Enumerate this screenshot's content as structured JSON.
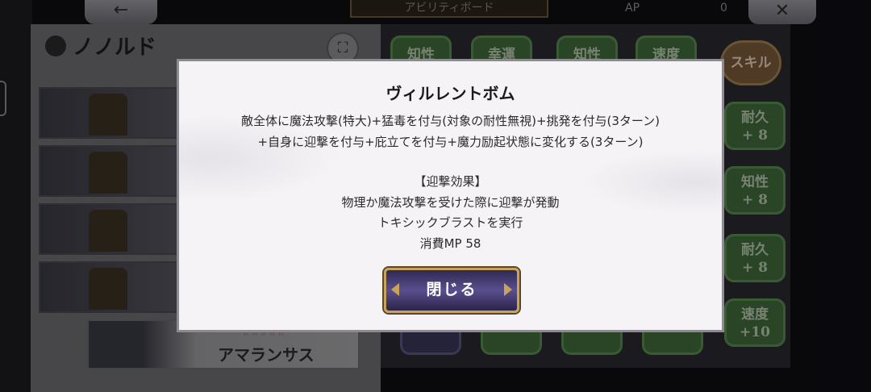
{
  "header": {
    "back_icon": "←",
    "title": "アビリティボード",
    "ap_label": "AP",
    "ap_value": "0",
    "close_icon": "✕"
  },
  "character": {
    "name": "ノノルド",
    "swap_icon": "⛶"
  },
  "unit_list": {
    "selected_name": "アマランサス",
    "stars": "☆☆☆☆☆"
  },
  "board": {
    "top_nodes": [
      "知性",
      "幸運",
      "知性",
      "速度"
    ],
    "skill_badge": "スキル",
    "side_nodes": [
      {
        "label": "耐久",
        "value": "+ 8"
      },
      {
        "label": "知性",
        "value": "+ 8"
      },
      {
        "label": "耐久",
        "value": "+ 8"
      },
      {
        "label": "速度",
        "value": "+10"
      }
    ]
  },
  "dialog": {
    "title": "ヴィルレントボム",
    "lines": [
      "敵全体に魔法攻撃(特大)+猛毒を付与(対象の耐性無視)+挑発を付与(3ターン)",
      "+自身に迎撃を付与+庇立てを付与+魔力励起状態に変化する(3ターン)",
      "【迎撃効果】",
      "物理か魔法攻撃を受けた際に迎撃が発動",
      "トキシックブラストを実行",
      "消費MP 58"
    ],
    "close_label": "閉じる"
  }
}
